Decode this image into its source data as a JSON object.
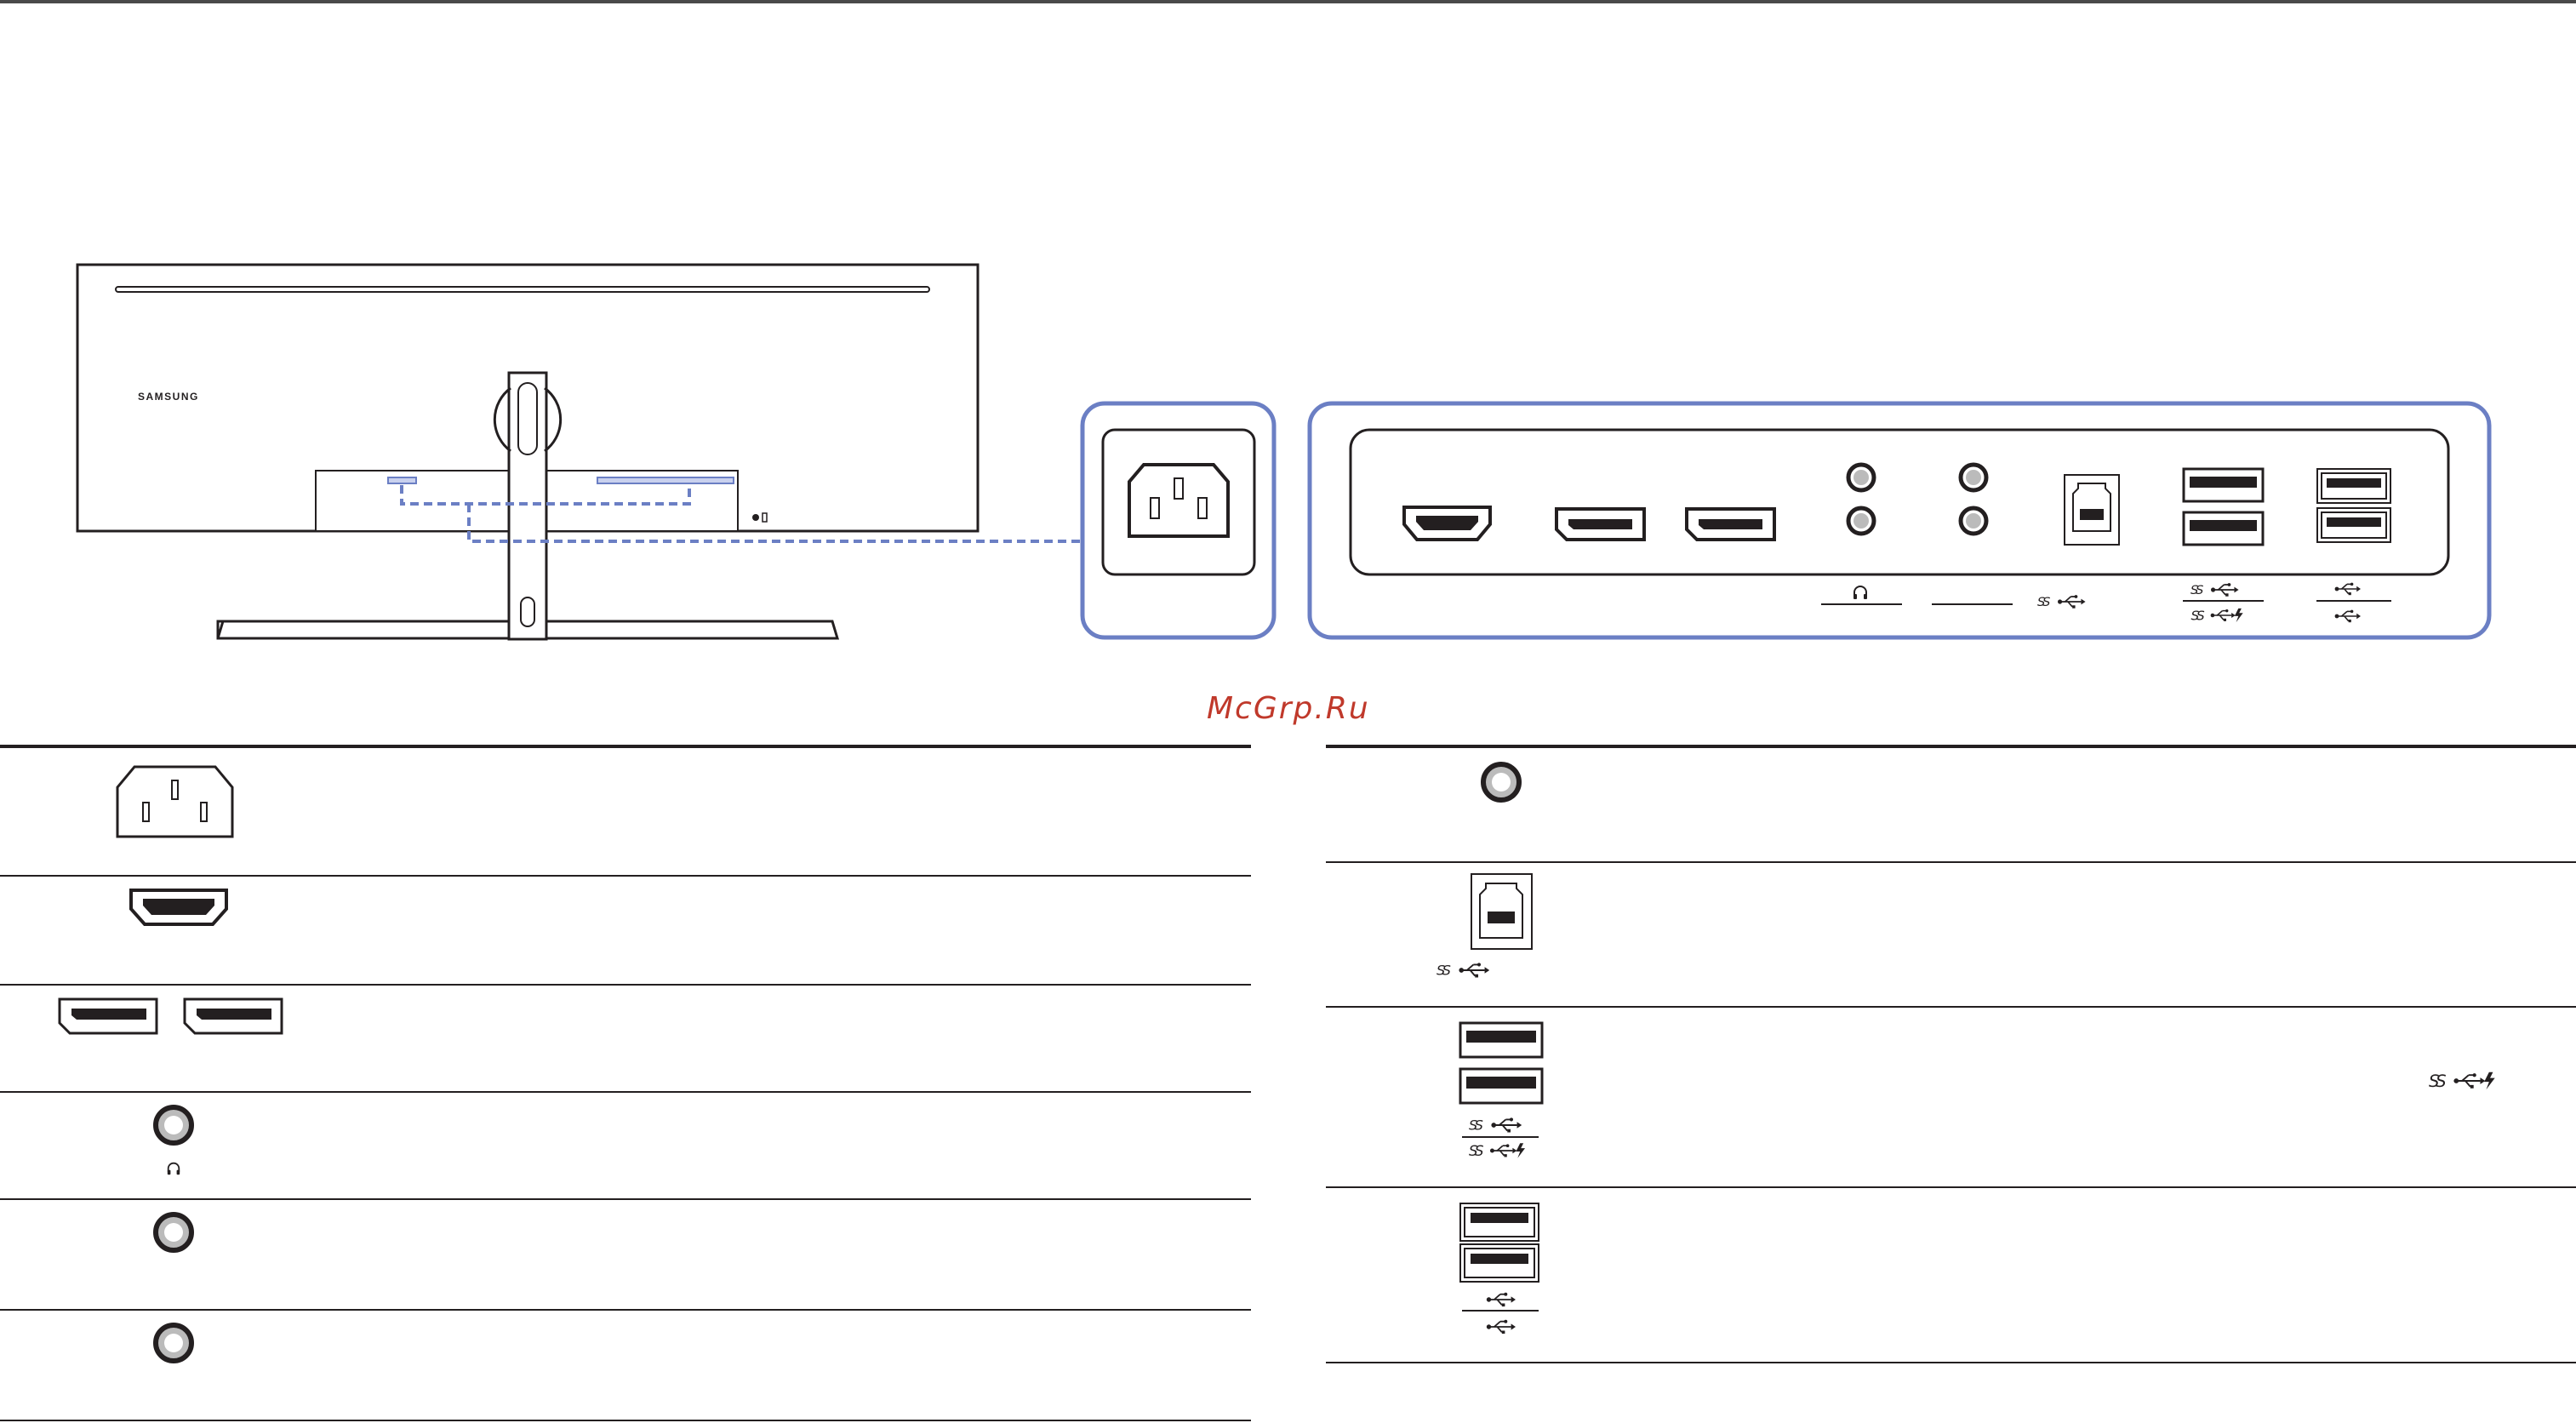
{
  "brand": {
    "logo_text": "SAMSUNG"
  },
  "watermark": "McGrp.Ru",
  "colors": {
    "line": "#231f20",
    "highlight": "#6b7fc4",
    "highlight_fill": "#c9d1ee",
    "watermark": "#c0392b"
  },
  "ports_panel": {
    "icons": [
      "hdmi-port-icon",
      "displayport-icon",
      "displayport-icon",
      "audio-jack-icon",
      "audio-jack-icon",
      "audio-jack-icon",
      "audio-jack-icon",
      "usb-b-port-icon",
      "usb-a-port-icon",
      "usb-a-port-icon",
      "usb-a-port-icon",
      "usb-a-port-icon"
    ],
    "labels": [
      "headphone-icon",
      "usb-superspeed-icon",
      "usb-superspeed-icon",
      "usb-superspeed-charging-icon",
      "usb-icon",
      "usb-icon"
    ]
  },
  "table_left": {
    "rows": [
      {
        "icon": "power-inlet-icon"
      },
      {
        "icon": "hdmi-port-icon"
      },
      {
        "icon": "displayport-icon"
      },
      {
        "icon": "audio-jack-icon",
        "label_icon": "headphone-icon"
      },
      {
        "icon": "audio-jack-icon"
      },
      {
        "icon": "audio-jack-icon"
      }
    ]
  },
  "table_right": {
    "rows": [
      {
        "icon": "audio-jack-icon"
      },
      {
        "icon": "usb-b-port-icon",
        "label_icon": "usb-superspeed-icon"
      },
      {
        "icon": "usb-a-port-icon",
        "label_icon": "usb-superspeed-icon",
        "extra_icon": "usb-superspeed-charging-icon"
      },
      {
        "icon": "usb-a-port-icon",
        "label_icon": "usb-icon"
      }
    ]
  }
}
